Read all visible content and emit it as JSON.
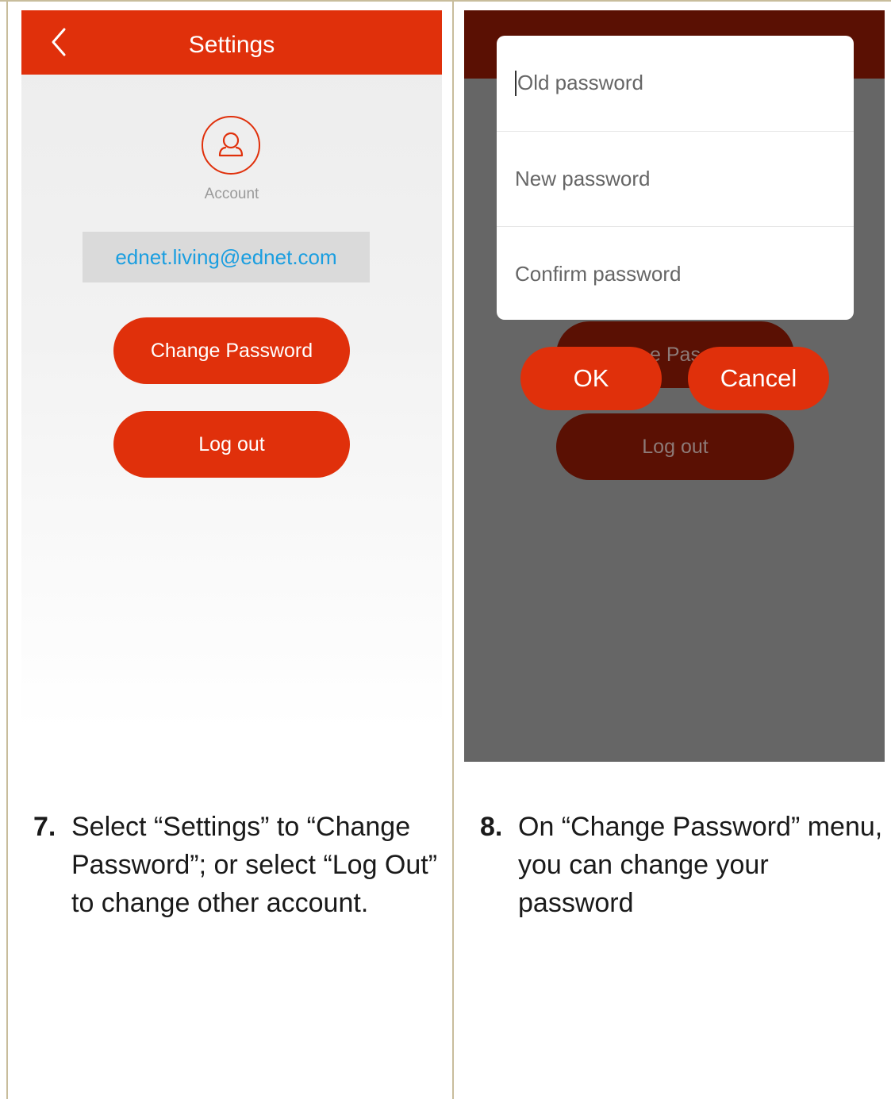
{
  "left_screen": {
    "header": {
      "title": "Settings"
    },
    "account_label": "Account",
    "email": "ednet.living@ednet.com",
    "change_password_label": "Change Password",
    "logout_label": "Log out"
  },
  "right_screen": {
    "dialog": {
      "old_password_placeholder": "Old password",
      "new_password_placeholder": "New password",
      "confirm_password_placeholder": "Confirm password",
      "ok_label": "OK",
      "cancel_label": "Cancel"
    },
    "background": {
      "change_password_partial": "e Pas",
      "logout_label": "Log out"
    }
  },
  "captions": {
    "left": {
      "number": "7.",
      "text": "Select “Settings” to “Change Password”; or select “Log Out” to change other account."
    },
    "right": {
      "number": "8.",
      "text": "On “Change Password” menu, you can change your password"
    }
  },
  "colors": {
    "accent": "#e0300b",
    "dimmed_accent": "#5a1003",
    "overlay": "#666666",
    "email_text": "#1a9ee0"
  }
}
